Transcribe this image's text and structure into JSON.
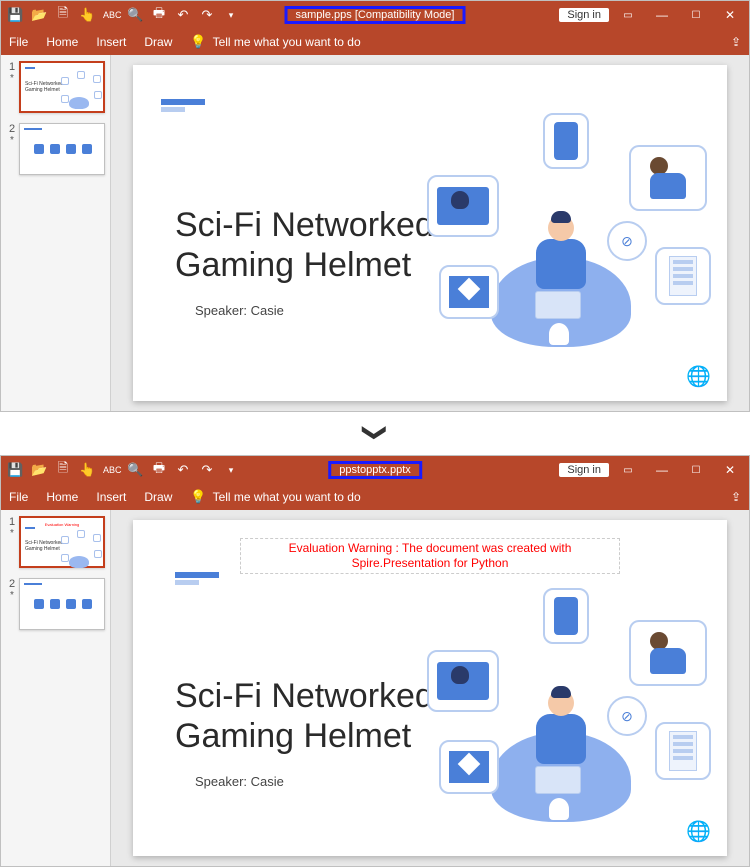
{
  "top": {
    "title": "sample.pps [Compatibility Mode]",
    "signin": "Sign in",
    "menu": {
      "file": "File",
      "home": "Home",
      "insert": "Insert",
      "draw": "Draw",
      "tellme": "Tell me what you want to do"
    },
    "thumbs": [
      {
        "num": "1",
        "star": "*",
        "title": "Sci-Fi Networked Gaming Helmet",
        "selected": true
      },
      {
        "num": "2",
        "star": "*",
        "title": "",
        "selected": false
      }
    ],
    "slide": {
      "title_l1": "Sci-Fi Networked",
      "title_l2": "Gaming Helmet",
      "speaker": "Speaker: Casie"
    }
  },
  "bottom": {
    "title": "ppstopptx.pptx",
    "signin": "Sign in",
    "menu": {
      "file": "File",
      "home": "Home",
      "insert": "Insert",
      "draw": "Draw",
      "tellme": "Tell me what you want to do"
    },
    "thumbs": [
      {
        "num": "1",
        "star": "*",
        "title": "Sci-Fi Networked Gaming Helmet",
        "selected": true
      },
      {
        "num": "2",
        "star": "*",
        "title": "",
        "selected": false
      }
    ],
    "slide": {
      "warning": "Evaluation Warning : The document was created with Spire.Presentation for Python",
      "title_l1": "Sci-Fi Networked",
      "title_l2": "Gaming Helmet",
      "speaker": "Speaker: Casie"
    }
  },
  "connector_glyph": "❯"
}
